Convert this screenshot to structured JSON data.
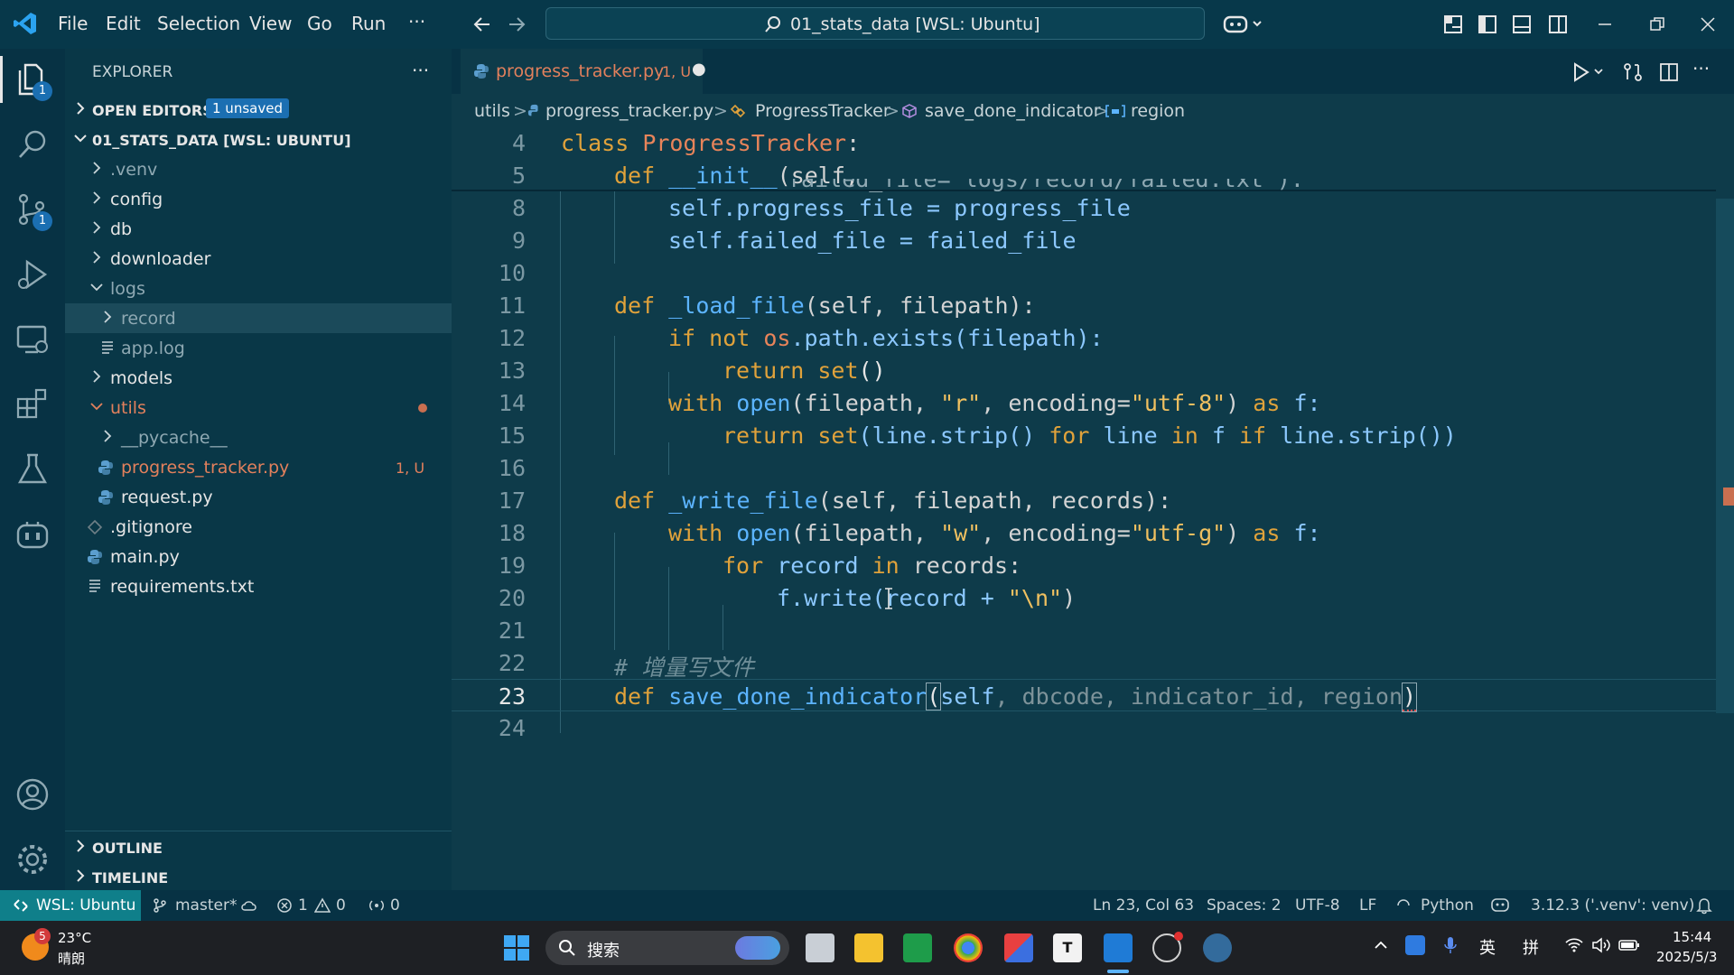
{
  "titlebar": {
    "menu": [
      "File",
      "Edit",
      "Selection",
      "View",
      "Go",
      "Run",
      "···"
    ],
    "search_text": "01_stats_data [WSL: Ubuntu]"
  },
  "activity": {
    "explorer_badge": "1",
    "scm_badge": "1"
  },
  "sidebar": {
    "title": "EXPLORER",
    "more": "···",
    "open_editors": "OPEN EDITORS",
    "unsaved_badge": "1 unsaved",
    "root": "01_STATS_DATA [WSL: UBUNTU]",
    "items": [
      {
        "label": ".venv"
      },
      {
        "label": "config"
      },
      {
        "label": "db"
      },
      {
        "label": "downloader"
      },
      {
        "label": "logs"
      },
      {
        "label": "record"
      },
      {
        "label": "app.log"
      },
      {
        "label": "models"
      },
      {
        "label": "utils"
      },
      {
        "label": "__pycache__"
      },
      {
        "label": "progress_tracker.py",
        "status": "1, U"
      },
      {
        "label": "request.py"
      },
      {
        "label": ".gitignore"
      },
      {
        "label": "main.py"
      },
      {
        "label": "requirements.txt"
      }
    ],
    "outline": "OUTLINE",
    "timeline": "TIMELINE"
  },
  "tab": {
    "label": "progress_tracker.py",
    "status": "1, U",
    "dirty": "●"
  },
  "breadcrumbs": [
    "utils",
    "progress_tracker.py",
    "ProgressTracker",
    "save_done_indicator",
    "region"
  ],
  "code": {
    "l4": {
      "num": "4",
      "kw": "class",
      "name": "ProgressTracker",
      "end": ":"
    },
    "l5": {
      "num": "5",
      "kw": "def",
      "name": "__init__",
      "rest": "(self,"
    },
    "l7": {
      "text": "failed_file=\"logs/record/failed.txt\"):"
    },
    "l8": {
      "num": "8",
      "text": "self.progress_file = progress_file"
    },
    "l9": {
      "num": "9",
      "text": "self.failed_file = failed_file"
    },
    "l10": {
      "num": "10"
    },
    "l11": {
      "num": "11",
      "kw": "def",
      "name": "_load_file",
      "rest": "(self, filepath):"
    },
    "l12": {
      "num": "12",
      "kw": "if not",
      "mod": "os",
      "rest": ".path.exists(filepath):"
    },
    "l13": {
      "num": "13",
      "kw": "return",
      "fn": "set",
      "rest": "()"
    },
    "l14": {
      "num": "14",
      "kw": "with",
      "fn": "open",
      "a": "(filepath, ",
      "s1": "\"r\"",
      "b": ", encoding=",
      "s2": "\"utf-8\"",
      "c": ") ",
      "kw2": "as",
      "d": " f:"
    },
    "l15": {
      "num": "15",
      "kw": "return",
      "fn": "set",
      "rest": "(line.strip() ",
      "for": "for",
      "mid": " line ",
      "in": "in",
      "mid2": " f ",
      "if": "if",
      "end": " line.strip())"
    },
    "l16": {
      "num": "16"
    },
    "l17": {
      "num": "17",
      "kw": "def",
      "name": "_write_file",
      "rest": "(self, filepath, records):"
    },
    "l18": {
      "num": "18",
      "kw": "with",
      "fn": "open",
      "a": "(filepath, ",
      "s1": "\"w\"",
      "b": ", encoding=",
      "s2": "\"utf-g\"",
      "c": ") ",
      "kw2": "as",
      "d": " f:"
    },
    "l19": {
      "num": "19",
      "kw": "for",
      "a": " record ",
      "in": "in",
      "b": " records:"
    },
    "l20": {
      "num": "20",
      "a": "f.write(record + ",
      "s": "\"\\n\"",
      "b": ")"
    },
    "l21": {
      "num": "21"
    },
    "l22": {
      "num": "22",
      "comment": "# 增量写文件"
    },
    "l23": {
      "num": "23",
      "kw": "def",
      "name": "save_done_indicator",
      "open": "(",
      "self": "self",
      "params": ", dbcode, indicator_id, region",
      "close": ")"
    },
    "l24": {
      "num": "24"
    }
  },
  "statusbar": {
    "remote": "WSL: Ubuntu",
    "branch": "master*",
    "errors": "1",
    "warnings": "0",
    "ports": "0",
    "position": "Ln 23, Col 63",
    "spaces": "Spaces: 2",
    "encoding": "UTF-8",
    "eol": "LF",
    "language": "Python",
    "interpreter": "3.12.3 ('.venv': venv)"
  },
  "taskbar": {
    "weather_badge": "5",
    "temp": "23°C",
    "condition": "晴朗",
    "search": "搜索",
    "ime1": "英",
    "ime2": "拼",
    "time": "15:44",
    "date": "2025/5/3"
  },
  "colors": {
    "accent": "#0f7f8a",
    "modified": "#e2805c",
    "editor_bg": "#0e3b4a"
  }
}
